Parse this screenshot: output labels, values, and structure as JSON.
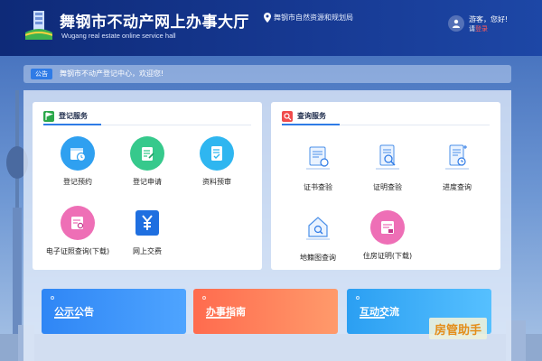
{
  "header": {
    "title": "舞钢市不动产网上办事大厅",
    "subtitle": "Wugang real estate online service hall",
    "location": "舞钢市自然资源和规划局",
    "greeting": "游客，您好!",
    "login_prefix": "请",
    "login_link": "登录"
  },
  "notice": {
    "badge": "公告",
    "text": "舞钢市不动产登记中心，欢迎您!"
  },
  "registration": {
    "title": "登记服务",
    "items": [
      {
        "label": "登记预约",
        "icon": "calendar-clock-icon",
        "color": "#2fa0f0"
      },
      {
        "label": "登记申请",
        "icon": "edit-document-icon",
        "color": "#36c98c"
      },
      {
        "label": "资料预审",
        "icon": "document-check-icon",
        "color": "#2fb6f0"
      },
      {
        "label": "电子证照查询(下载)",
        "icon": "certificate-search-icon",
        "color": "#ee6fb6"
      },
      {
        "label": "网上交费",
        "icon": "yuan-payment-icon",
        "color": "#1f6fe0"
      }
    ]
  },
  "query": {
    "title": "查询服务",
    "items": [
      {
        "label": "证书查验",
        "icon": "certificate-verify-icon"
      },
      {
        "label": "证明查验",
        "icon": "proof-verify-icon"
      },
      {
        "label": "进度查询",
        "icon": "progress-query-icon"
      },
      {
        "label": "地籍图查询",
        "icon": "house-search-icon"
      },
      {
        "label": "住房证明(下载)",
        "icon": "housing-certificate-icon"
      }
    ]
  },
  "tiles": [
    {
      "label": "公示公告"
    },
    {
      "label": "办事指南"
    },
    {
      "label": "互动交流"
    }
  ],
  "watermark": "房管助手",
  "colors": {
    "header": "#173a94",
    "accent": "#2f7be6",
    "tile_blue": "#2f86f5",
    "tile_orange": "#ff6b4e",
    "tile_cyan": "#2b9ff2"
  }
}
